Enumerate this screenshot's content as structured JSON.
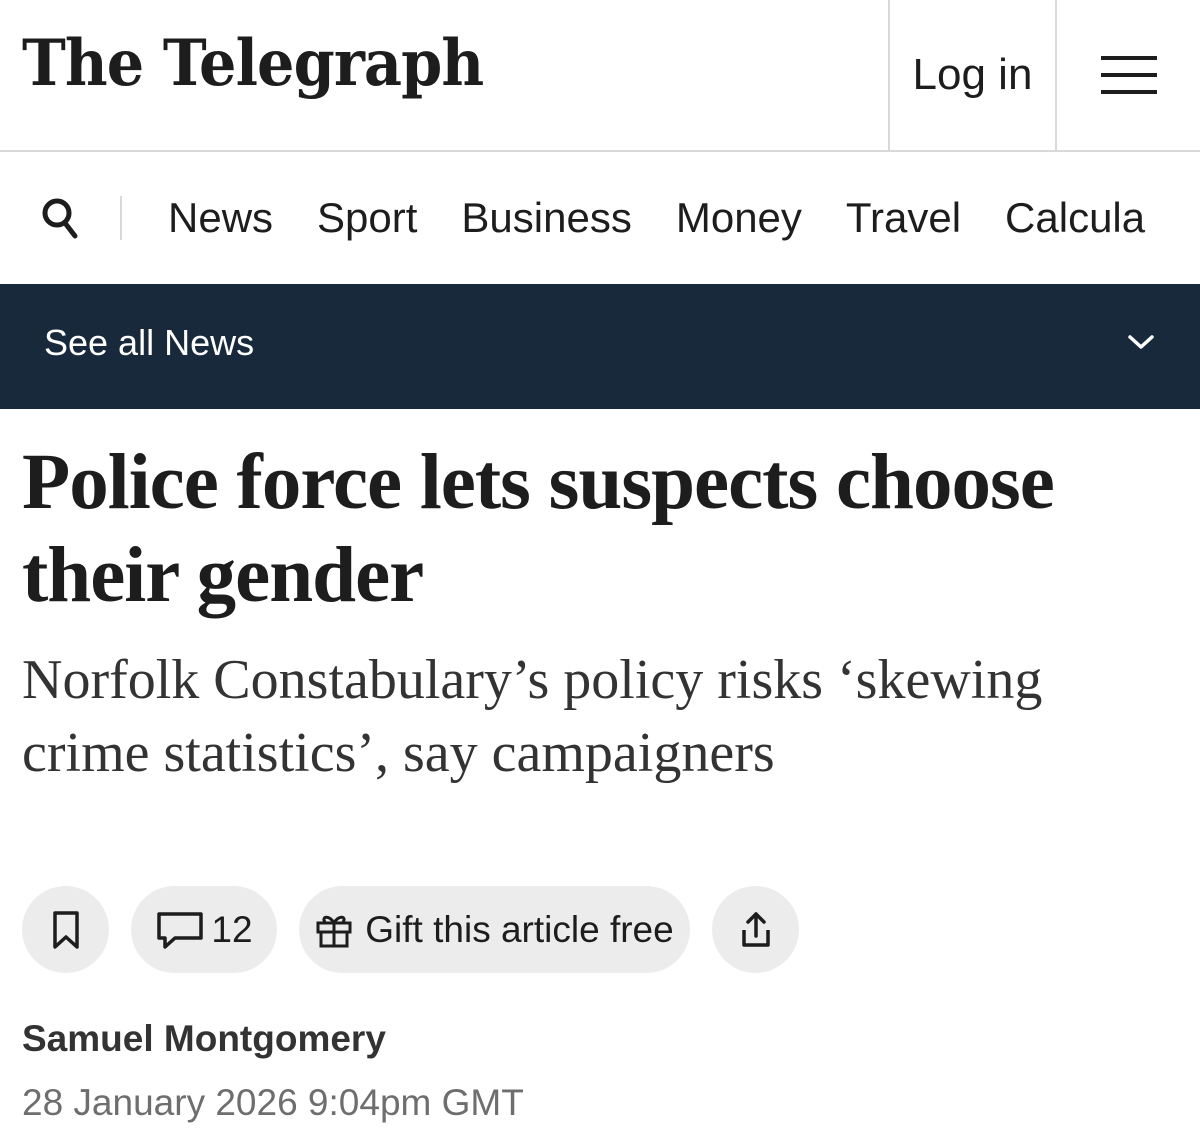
{
  "header": {
    "logo_text": "The Telegraph",
    "login_label": "Log in",
    "menu_icon": "hamburger-menu-icon"
  },
  "nav": {
    "search_icon": "search-icon",
    "items": [
      {
        "label": "News"
      },
      {
        "label": "Sport"
      },
      {
        "label": "Business"
      },
      {
        "label": "Money"
      },
      {
        "label": "Travel"
      },
      {
        "label": "Calcula"
      }
    ]
  },
  "subnav": {
    "label": "See all News",
    "icon": "chevron-down-icon",
    "background": "#17293b"
  },
  "article": {
    "headline": "Police force lets suspects choose their gender",
    "standfirst": "Norfolk Constabulary’s policy risks ‘skewing crime statistics’, say campaigners",
    "actions": {
      "bookmark_icon": "bookmark-icon",
      "comment_icon": "comment-icon",
      "comment_count": "12",
      "gift_icon": "gift-icon",
      "gift_label": "Gift this article free",
      "share_icon": "share-icon"
    },
    "author": "Samuel Montgomery",
    "date": "28 January 2026 9:04pm GMT"
  }
}
